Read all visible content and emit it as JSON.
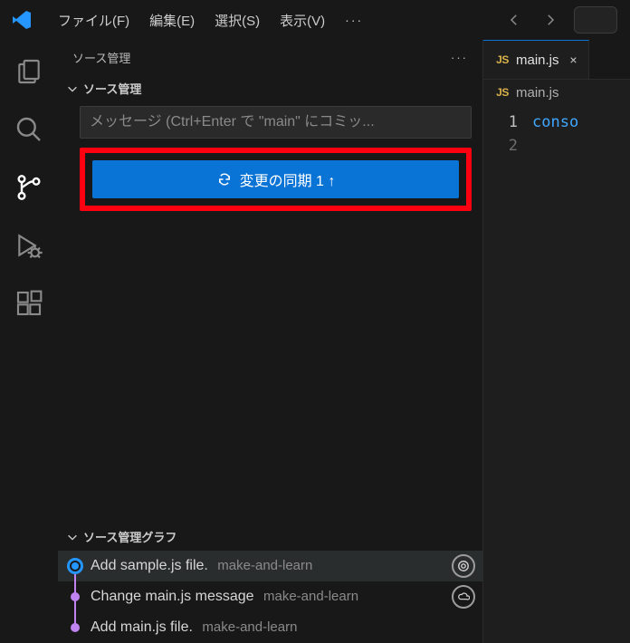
{
  "menu": {
    "file": "ファイル(F)",
    "edit": "編集(E)",
    "select": "選択(S)",
    "view": "表示(V)",
    "more": "···"
  },
  "sidebar": {
    "title": "ソース管理",
    "section_title": "ソース管理",
    "commit_placeholder": "メッセージ (Ctrl+Enter で \"main\" にコミッ...",
    "sync_label": "変更の同期 1 ↑",
    "graph_title": "ソース管理グラフ",
    "commits": [
      {
        "message": "Add sample.js file.",
        "author": "make-and-learn",
        "current": true,
        "action": "target"
      },
      {
        "message": "Change main.js message",
        "author": "make-and-learn",
        "current": false,
        "action": "cloud"
      },
      {
        "message": "Add main.js file.",
        "author": "make-and-learn",
        "current": false,
        "action": null
      }
    ]
  },
  "editor": {
    "tab_name": "main.js",
    "breadcrumb_name": "main.js",
    "lines": [
      "conso",
      ""
    ]
  },
  "chart_data": null
}
